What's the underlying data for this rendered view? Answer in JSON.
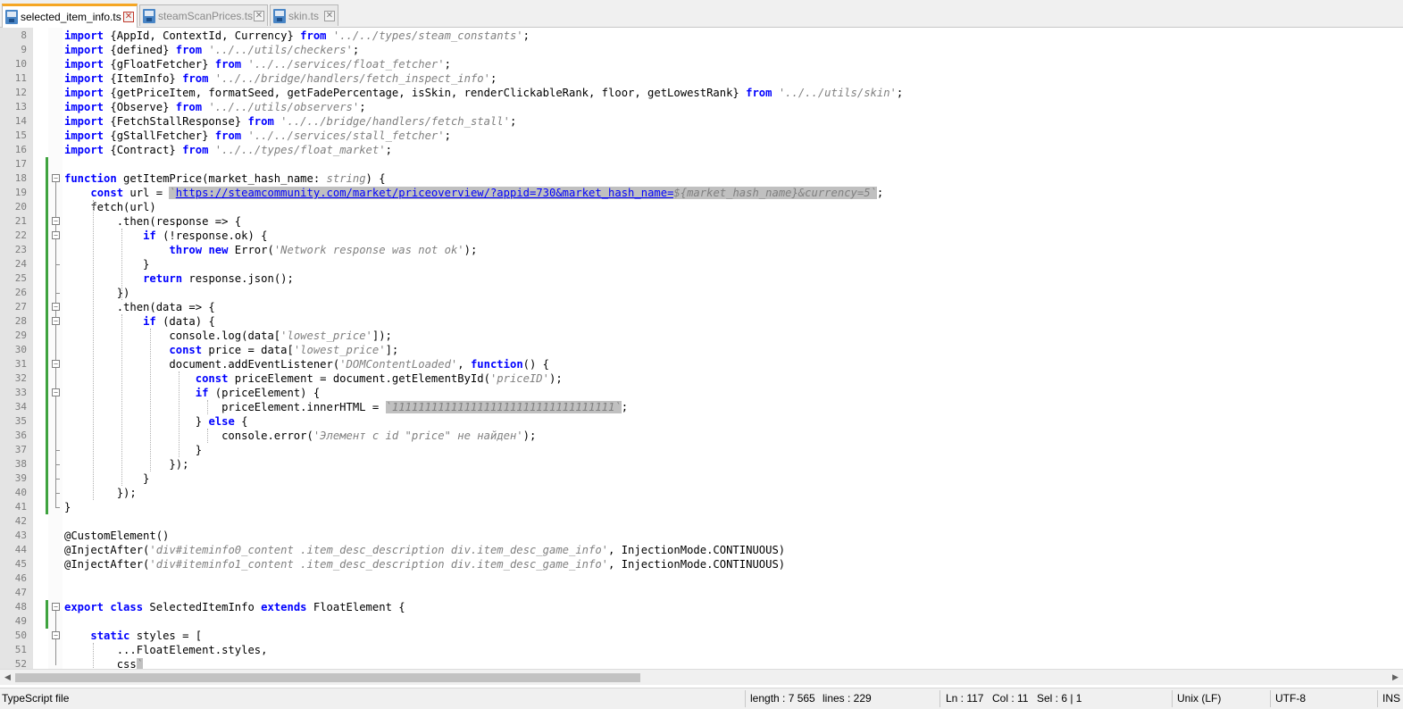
{
  "tabs": [
    {
      "label": "selected_item_info.ts",
      "active": true
    },
    {
      "label": "steamScanPrices.ts",
      "active": false
    },
    {
      "label": "skin.ts",
      "active": false
    }
  ],
  "code_lines": [
    {
      "num": "8",
      "tokens": [
        [
          "kw",
          "import"
        ],
        [
          "p",
          " {AppId, ContextId, Currency} "
        ],
        [
          "kw",
          "from"
        ],
        [
          "p",
          " "
        ],
        [
          "str",
          "'../../types/steam_constants'"
        ],
        [
          "p",
          ";"
        ]
      ]
    },
    {
      "num": "9",
      "tokens": [
        [
          "kw",
          "import"
        ],
        [
          "p",
          " {defined} "
        ],
        [
          "kw",
          "from"
        ],
        [
          "p",
          " "
        ],
        [
          "str",
          "'../../utils/checkers'"
        ],
        [
          "p",
          ";"
        ]
      ]
    },
    {
      "num": "10",
      "tokens": [
        [
          "kw",
          "import"
        ],
        [
          "p",
          " {gFloatFetcher} "
        ],
        [
          "kw",
          "from"
        ],
        [
          "p",
          " "
        ],
        [
          "str",
          "'../../services/float_fetcher'"
        ],
        [
          "p",
          ";"
        ]
      ]
    },
    {
      "num": "11",
      "tokens": [
        [
          "kw",
          "import"
        ],
        [
          "p",
          " {ItemInfo} "
        ],
        [
          "kw",
          "from"
        ],
        [
          "p",
          " "
        ],
        [
          "str",
          "'../../bridge/handlers/fetch_inspect_info'"
        ],
        [
          "p",
          ";"
        ]
      ]
    },
    {
      "num": "12",
      "tokens": [
        [
          "kw",
          "import"
        ],
        [
          "p",
          " {getPriceItem, formatSeed, getFadePercentage, isSkin, renderClickableRank, floor, getLowestRank} "
        ],
        [
          "kw",
          "from"
        ],
        [
          "p",
          " "
        ],
        [
          "str",
          "'../../utils/skin'"
        ],
        [
          "p",
          ";"
        ]
      ]
    },
    {
      "num": "13",
      "tokens": [
        [
          "kw",
          "import"
        ],
        [
          "p",
          " {Observe} "
        ],
        [
          "kw",
          "from"
        ],
        [
          "p",
          " "
        ],
        [
          "str",
          "'../../utils/observers'"
        ],
        [
          "p",
          ";"
        ]
      ]
    },
    {
      "num": "14",
      "tokens": [
        [
          "kw",
          "import"
        ],
        [
          "p",
          " {FetchStallResponse} "
        ],
        [
          "kw",
          "from"
        ],
        [
          "p",
          " "
        ],
        [
          "str",
          "'../../bridge/handlers/fetch_stall'"
        ],
        [
          "p",
          ";"
        ]
      ]
    },
    {
      "num": "15",
      "tokens": [
        [
          "kw",
          "import"
        ],
        [
          "p",
          " {gStallFetcher} "
        ],
        [
          "kw",
          "from"
        ],
        [
          "p",
          " "
        ],
        [
          "str",
          "'../../services/stall_fetcher'"
        ],
        [
          "p",
          ";"
        ]
      ]
    },
    {
      "num": "16",
      "tokens": [
        [
          "kw",
          "import"
        ],
        [
          "p",
          " {Contract} "
        ],
        [
          "kw",
          "from"
        ],
        [
          "p",
          " "
        ],
        [
          "str",
          "'../../types/float_market'"
        ],
        [
          "p",
          ";"
        ]
      ]
    },
    {
      "num": "17",
      "tokens": []
    },
    {
      "num": "18",
      "tokens": [
        [
          "kw",
          "function"
        ],
        [
          "p",
          " getItemPrice(market_hash_name: "
        ],
        [
          "str",
          "string"
        ],
        [
          "p",
          ") {"
        ]
      ]
    },
    {
      "num": "19",
      "tokens": [
        [
          "p",
          "    "
        ],
        [
          "kw",
          "const"
        ],
        [
          "p",
          " url = "
        ],
        [
          "sel",
          "`"
        ],
        [
          "selurl",
          "https://steamcommunity.com/market/priceoverview/?appid=730&market_hash_name="
        ],
        [
          "sel",
          "${market_hash_name}&currency=5`"
        ],
        [
          "p",
          ";"
        ]
      ]
    },
    {
      "num": "20",
      "tokens": [
        [
          "p",
          "    fetch(url)"
        ]
      ]
    },
    {
      "num": "21",
      "tokens": [
        [
          "p",
          "        .then(response => {"
        ]
      ]
    },
    {
      "num": "22",
      "tokens": [
        [
          "p",
          "            "
        ],
        [
          "kw",
          "if"
        ],
        [
          "p",
          " (!response.ok) {"
        ]
      ]
    },
    {
      "num": "23",
      "tokens": [
        [
          "p",
          "                "
        ],
        [
          "kw",
          "throw"
        ],
        [
          "p",
          " "
        ],
        [
          "kw",
          "new"
        ],
        [
          "p",
          " Error("
        ],
        [
          "str",
          "'Network response was not ok'"
        ],
        [
          "p",
          ");"
        ]
      ]
    },
    {
      "num": "24",
      "tokens": [
        [
          "p",
          "            }"
        ]
      ]
    },
    {
      "num": "25",
      "tokens": [
        [
          "p",
          "            "
        ],
        [
          "kw",
          "return"
        ],
        [
          "p",
          " response.json();"
        ]
      ]
    },
    {
      "num": "26",
      "tokens": [
        [
          "p",
          "        })"
        ]
      ]
    },
    {
      "num": "27",
      "tokens": [
        [
          "p",
          "        .then(data => {"
        ]
      ]
    },
    {
      "num": "28",
      "tokens": [
        [
          "p",
          "            "
        ],
        [
          "kw",
          "if"
        ],
        [
          "p",
          " (data) {"
        ]
      ]
    },
    {
      "num": "29",
      "tokens": [
        [
          "p",
          "                console.log(data["
        ],
        [
          "str",
          "'lowest_price'"
        ],
        [
          "p",
          "]);"
        ]
      ]
    },
    {
      "num": "30",
      "tokens": [
        [
          "p",
          "                "
        ],
        [
          "kw",
          "const"
        ],
        [
          "p",
          " price = data["
        ],
        [
          "str",
          "'lowest_price'"
        ],
        [
          "p",
          "];"
        ]
      ]
    },
    {
      "num": "31",
      "tokens": [
        [
          "p",
          "                document.addEventListener("
        ],
        [
          "str",
          "'DOMContentLoaded'"
        ],
        [
          "p",
          ", "
        ],
        [
          "kw",
          "function"
        ],
        [
          "p",
          "() {"
        ]
      ]
    },
    {
      "num": "32",
      "tokens": [
        [
          "p",
          "                    "
        ],
        [
          "kw",
          "const"
        ],
        [
          "p",
          " priceElement = document.getElementById("
        ],
        [
          "str",
          "'priceID'"
        ],
        [
          "p",
          ");"
        ]
      ]
    },
    {
      "num": "33",
      "tokens": [
        [
          "p",
          "                    "
        ],
        [
          "kw",
          "if"
        ],
        [
          "p",
          " (priceElement) {"
        ]
      ]
    },
    {
      "num": "34",
      "tokens": [
        [
          "p",
          "                        priceElement.innerHTML = "
        ],
        [
          "sel",
          "`1111111111111111111111111111111111`"
        ],
        [
          "p",
          ";"
        ]
      ]
    },
    {
      "num": "35",
      "tokens": [
        [
          "p",
          "                    } "
        ],
        [
          "kw",
          "else"
        ],
        [
          "p",
          " {"
        ]
      ]
    },
    {
      "num": "36",
      "tokens": [
        [
          "p",
          "                        console.error("
        ],
        [
          "str",
          "'Элемент с id \"price\" не найден'"
        ],
        [
          "p",
          ");"
        ]
      ]
    },
    {
      "num": "37",
      "tokens": [
        [
          "p",
          "                    }"
        ]
      ]
    },
    {
      "num": "38",
      "tokens": [
        [
          "p",
          "                });"
        ]
      ]
    },
    {
      "num": "39",
      "tokens": [
        [
          "p",
          "            }"
        ]
      ]
    },
    {
      "num": "40",
      "tokens": [
        [
          "p",
          "        });"
        ]
      ]
    },
    {
      "num": "41",
      "tokens": [
        [
          "p",
          "}"
        ]
      ]
    },
    {
      "num": "42",
      "tokens": []
    },
    {
      "num": "43",
      "tokens": [
        [
          "p",
          "@CustomElement()"
        ]
      ]
    },
    {
      "num": "44",
      "tokens": [
        [
          "p",
          "@InjectAfter("
        ],
        [
          "str",
          "'div#iteminfo0_content .item_desc_description div.item_desc_game_info'"
        ],
        [
          "p",
          ", InjectionMode.CONTINUOUS)"
        ]
      ]
    },
    {
      "num": "45",
      "tokens": [
        [
          "p",
          "@InjectAfter("
        ],
        [
          "str",
          "'div#iteminfo1_content .item_desc_description div.item_desc_game_info'"
        ],
        [
          "p",
          ", InjectionMode.CONTINUOUS)"
        ]
      ]
    },
    {
      "num": "46",
      "tokens": []
    },
    {
      "num": "47",
      "tokens": []
    },
    {
      "num": "48",
      "tokens": [
        [
          "kw",
          "export"
        ],
        [
          "p",
          " "
        ],
        [
          "kw",
          "class"
        ],
        [
          "p",
          " SelectedItemInfo "
        ],
        [
          "kw",
          "extends"
        ],
        [
          "p",
          " FloatElement {"
        ]
      ]
    },
    {
      "num": "49",
      "tokens": []
    },
    {
      "num": "50",
      "tokens": [
        [
          "p",
          "    "
        ],
        [
          "kw",
          "static"
        ],
        [
          "p",
          " styles = ["
        ]
      ]
    },
    {
      "num": "51",
      "tokens": [
        [
          "p",
          "        ...FloatElement.styles,"
        ]
      ]
    },
    {
      "num": "52",
      "tokens": [
        [
          "p",
          "        css"
        ],
        [
          "sel",
          "`"
        ]
      ]
    }
  ],
  "status": {
    "file_type": "TypeScript file",
    "length": "length : 7 565",
    "lines": "lines : 229",
    "ln": "Ln : 117",
    "col": "Col : 11",
    "sel": "Sel : 6 | 1",
    "eol": "Unix (LF)",
    "encoding": "UTF-8",
    "mode": "INS"
  },
  "colors": {
    "keyword": "#0000ff",
    "string": "#808080",
    "selection": "#c0c0c0",
    "change_marker": "#3fa33f",
    "active_tab_accent": "#f5a623"
  }
}
